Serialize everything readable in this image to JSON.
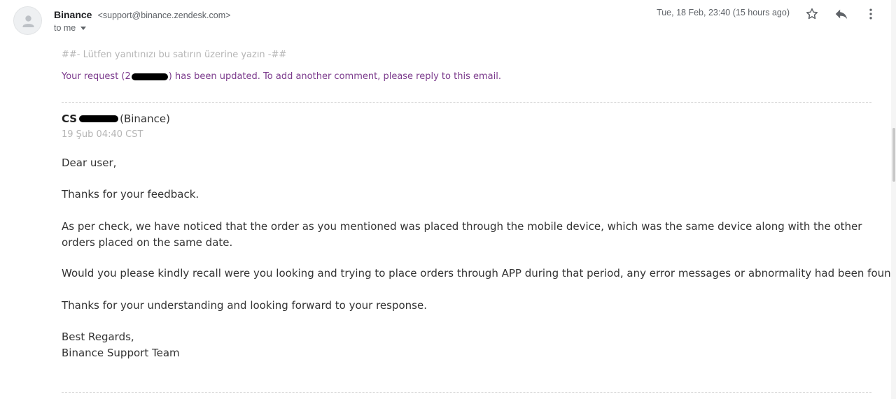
{
  "header": {
    "sender_name": "Binance",
    "sender_email": "<support@binance.zendesk.com>",
    "to_label": "to me",
    "date": "Tue, 18 Feb, 23:40 (15 hours ago)",
    "icons": [
      "person-avatar-icon",
      "chevron-down-icon",
      "star-icon",
      "reply-icon",
      "more-vert-icon"
    ]
  },
  "body": {
    "reply_marker": "##- Lütfen yanıtınızı bu satırın üzerine yazın -##",
    "update_prefix": "Your request (2",
    "update_suffix": ") has been updated. To add another comment, please reply to this email.",
    "author_prefix": "CS",
    "author_org": "(Binance)",
    "comment_date": "19 Şub 04:40 CST",
    "greeting": "Dear user,",
    "thanks": "Thanks for your feedback.",
    "para_check": "As per check, we have noticed that the order as you mentioned was placed through the mobile device, which was the same device along with the other orders placed on the same date.",
    "para_recall": "Would you please kindly recall were you looking and trying to place orders through APP during that period, any error messages or abnormality had been found.",
    "para_understanding": "Thanks for your understanding and looking forward to your response.",
    "regards": "Best Regards,",
    "signature": "Binance Support Team"
  },
  "colors": {
    "update_text": "#7b3a8c",
    "muted_text": "#b5b5b5",
    "body_text": "#333333"
  }
}
